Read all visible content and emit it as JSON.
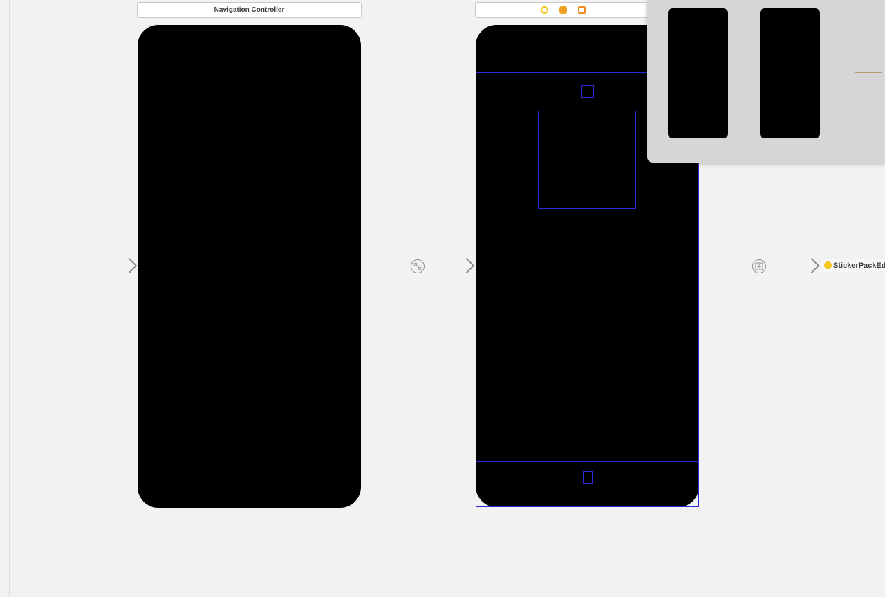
{
  "scenes": {
    "navigation_controller": {
      "title": "Navigation Controller"
    },
    "view_controller": {
      "dock_icons": [
        "view-controller-icon",
        "first-responder-icon",
        "exit-icon"
      ],
      "icon_colors": {
        "view_controller": "#f5c518",
        "first_responder": "#f0a020",
        "exit": "#f08a24"
      }
    },
    "storyboard_reference": {
      "label": "StickerPackEdit"
    }
  },
  "segues": [
    {
      "name": "entry-point",
      "kind": "initial"
    },
    {
      "name": "root-relationship",
      "kind": "relationship"
    },
    {
      "name": "show-segue",
      "kind": "show"
    }
  ],
  "colors": {
    "canvas": "#f2f2f2",
    "phone_fill": "#000000",
    "outline": "#2a2ad6",
    "connector": "#8e8e8e"
  }
}
